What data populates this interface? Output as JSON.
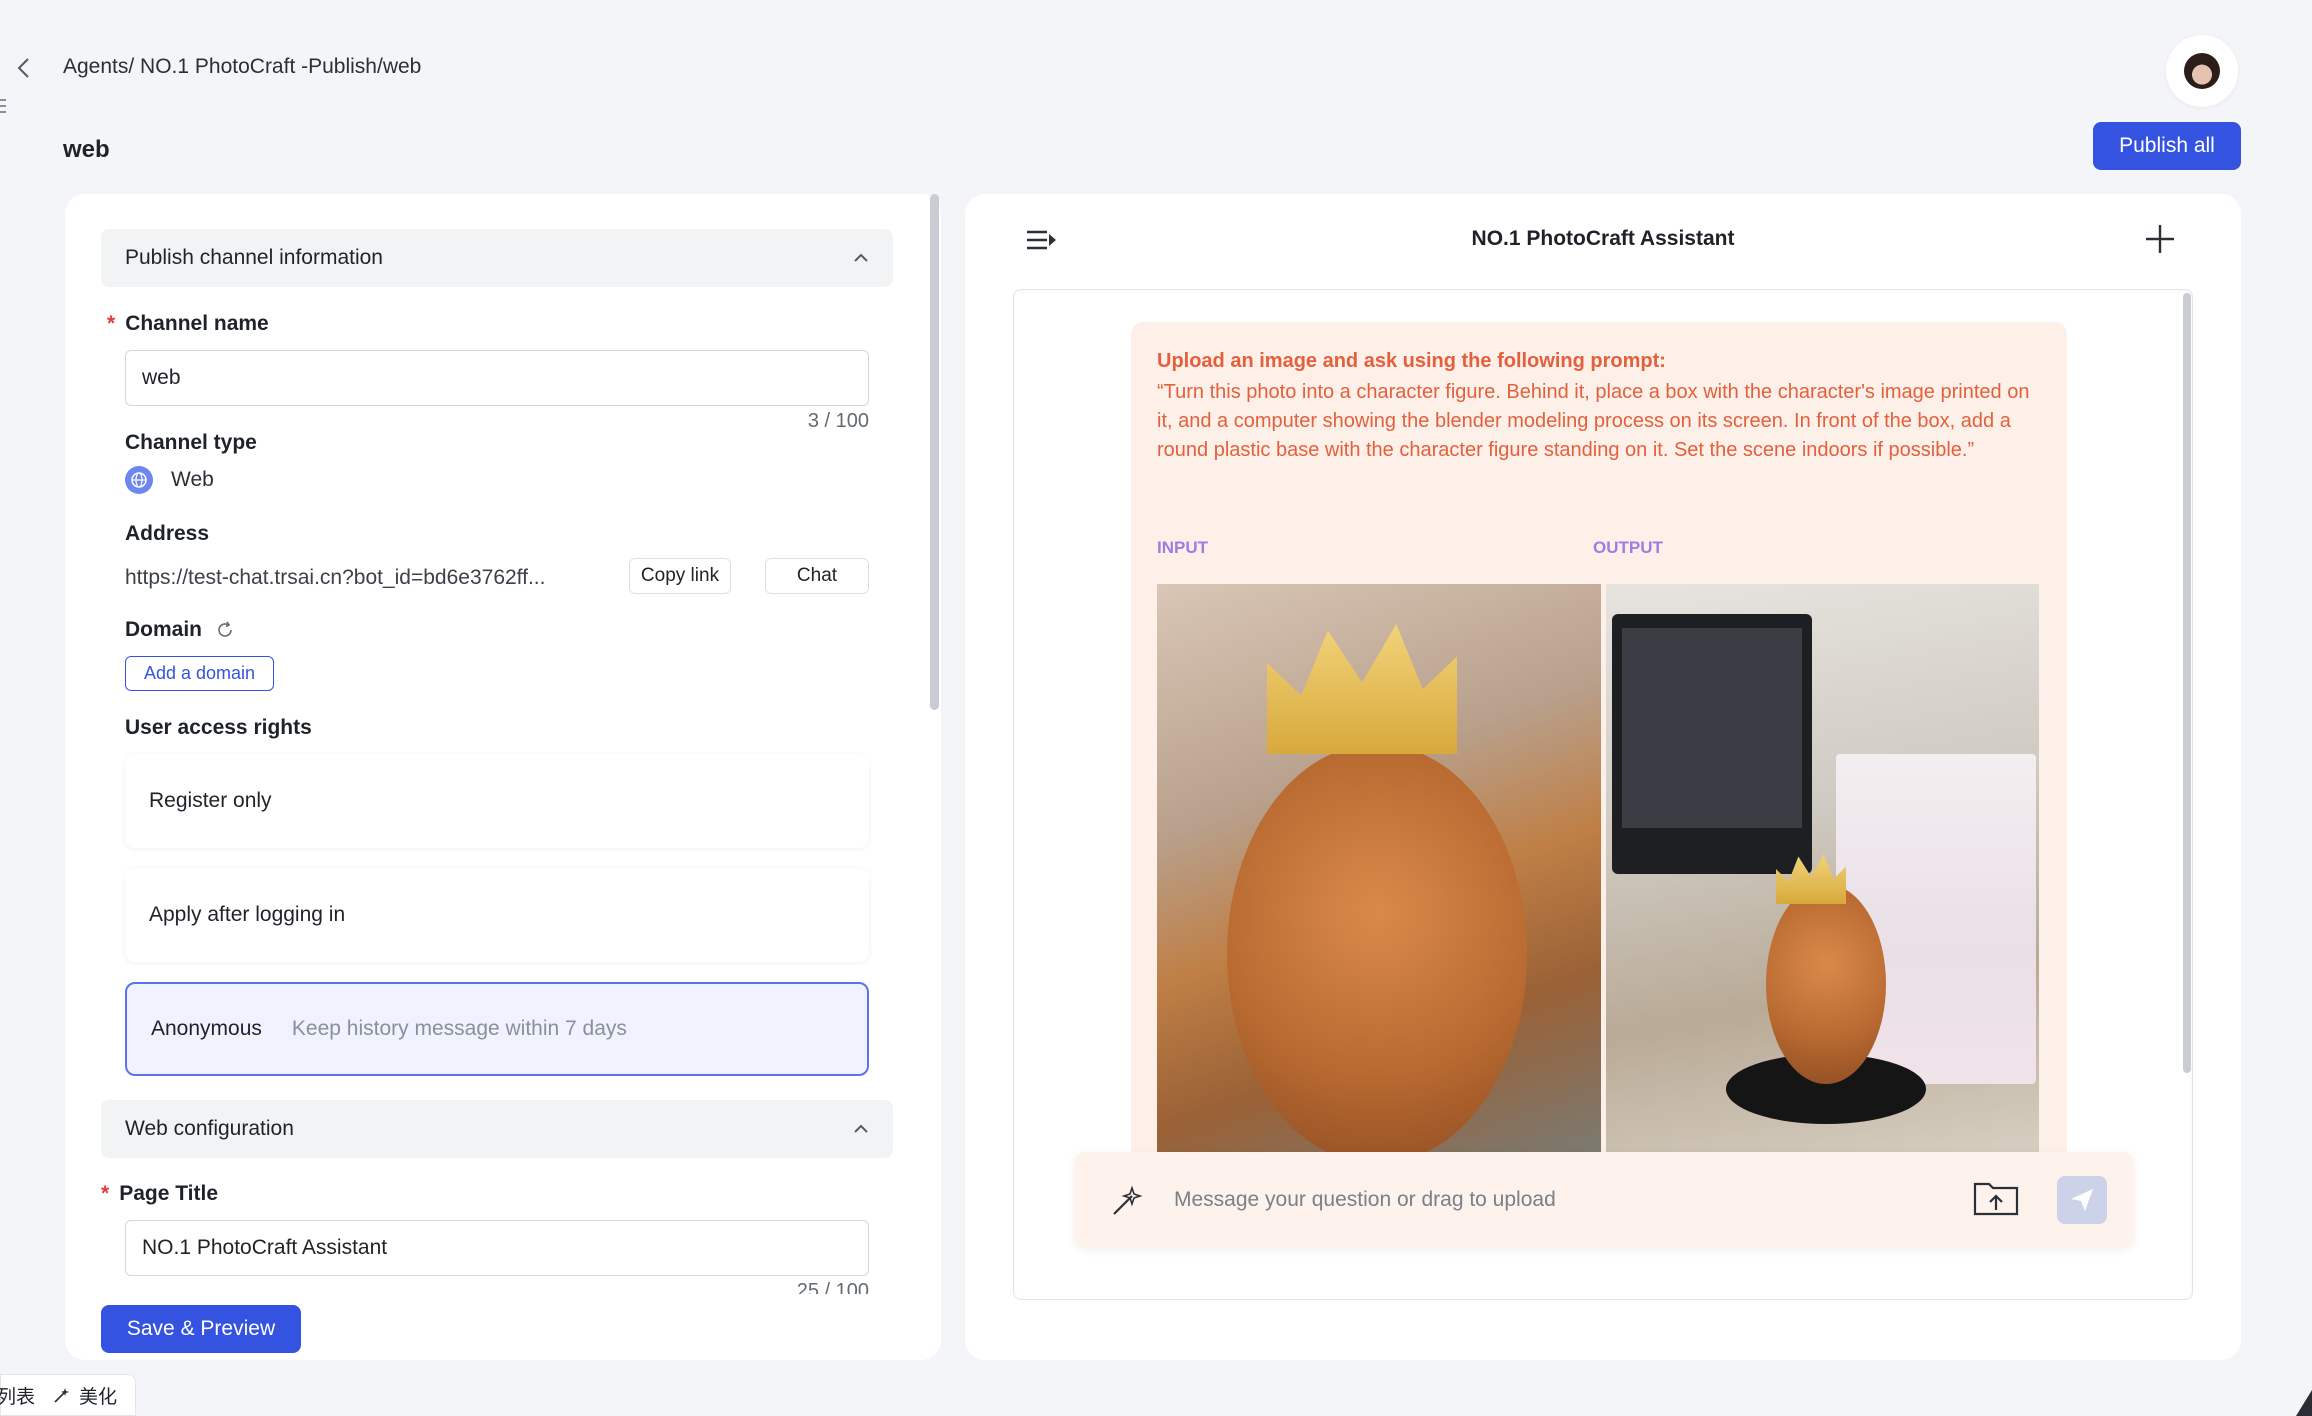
{
  "header": {
    "breadcrumb": "Agents/ NO.1 PhotoCraft -Publish/web",
    "page_title": "web",
    "publish_all_label": "Publish all"
  },
  "left_panel": {
    "section_publish": "Publish channel information",
    "channel_name_label": "Channel name",
    "channel_name_value": "web",
    "channel_name_counter": "3 / 100",
    "channel_type_label": "Channel type",
    "channel_type_value": "Web",
    "address_label": "Address",
    "address_value": "https://test-chat.trsai.cn?bot_id=bd6e3762ff...",
    "copy_link_label": "Copy link",
    "chat_label": "Chat",
    "domain_label": "Domain",
    "add_domain_label": "Add a domain",
    "access_label": "User access rights",
    "access_options": [
      {
        "label": "Register only",
        "hint": ""
      },
      {
        "label": "Apply after logging in",
        "hint": ""
      },
      {
        "label": "Anonymous",
        "hint": "Keep history message within 7 days"
      }
    ],
    "selected_access": "Anonymous",
    "section_web": "Web configuration",
    "page_title_label": "Page Title",
    "page_title_value": "NO.1 PhotoCraft Assistant",
    "page_title_counter": "25 / 100",
    "save_preview_label": "Save & Preview"
  },
  "right_panel": {
    "chat_title": "NO.1 PhotoCraft Assistant",
    "message": {
      "title": "Upload an image and ask using the following prompt:",
      "body": "“Turn this photo into a character figure. Behind it, place a box with the character's image printed on it, and a computer showing the blender modeling process on its screen. In front of the box, add a round plastic base with the character figure standing on it. Set the scene indoors if possible.”",
      "input_label": "INPUT",
      "output_label": "OUTPUT"
    },
    "input_placeholder": "Message your question or drag to upload"
  },
  "bottom_strip": {
    "item_1": "列表",
    "item_2": "美化"
  },
  "colors": {
    "primary": "#3453e0",
    "message_bg": "#fdf0e8",
    "message_text": "#e4603d",
    "label_purple": "#a07de0",
    "required": "#e5393b"
  },
  "icons": [
    "back-chevron-icon",
    "avatar",
    "globe-icon",
    "refresh-icon",
    "chevron-up-icon",
    "menu-collapse-icon",
    "plus-icon",
    "magic-wand-icon",
    "folder-upload-icon",
    "send-icon"
  ]
}
